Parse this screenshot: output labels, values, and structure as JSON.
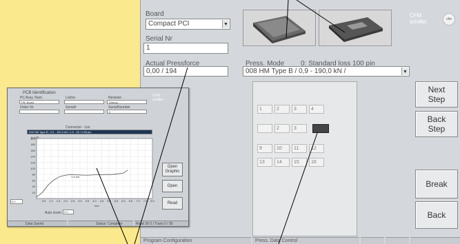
{
  "main": {
    "board_label": "Board",
    "board_value": "Compact PCI",
    "serial_label": "Serial Nr",
    "serial_value": "1",
    "actual_pressforce_label": "Actual Pressforce",
    "actual_pressforce_value": "0,00 / 194",
    "press_mode_label": "Press. Mode",
    "standard_label": "0: Standard loss 100 pin",
    "press_mode_value": "008  HM Type B / 0,9 - 190,0 kN /",
    "logo_text": [
      "CFM",
      "schiller"
    ],
    "buttons": {
      "next_step": [
        "Next",
        "Step"
      ],
      "back_step": [
        "Back",
        "Step"
      ],
      "break": "Break",
      "back": "Back"
    },
    "grid_rows": [
      [
        "1",
        "2",
        "3",
        "4"
      ],
      [
        "",
        "2",
        "3",
        ""
      ],
      [
        "9",
        "10",
        "11",
        "12"
      ],
      [
        "13",
        "14",
        "15",
        "16"
      ]
    ],
    "status_segments": [
      "Program Configuration",
      "Press. Data Control",
      "",
      "",
      ""
    ]
  },
  "inset": {
    "title": "PCB Identification",
    "fields": [
      {
        "label": "PC Assy. Num.",
        "value": "PB_Board"
      },
      {
        "label": "Lot/no.",
        "value": ""
      },
      {
        "label": "Revision",
        "value": "Startup"
      },
      {
        "label": "Order Nr.",
        "value": ""
      },
      {
        "label": "Serial#",
        "value": ""
      },
      {
        "label": "Serial/Number",
        "value": "0"
      }
    ],
    "graph_header": "Connector - List",
    "graph_selected": "008  HM Type B / 0,9 - 190,0 kN / 2.9 - 05 / 0.89 pin",
    "buttons": [
      "Open Graphic",
      "Open",
      "Read"
    ],
    "ylabel": "in kN",
    "xlabel": "mm",
    "left_field_value": "0.0",
    "auto_zoom_label": "Auto zoom",
    "auto_zoom_value": "0.0",
    "status_segments": [
      "Data Saved",
      "Status: Complete",
      "Read 36 0 / Trans 0 / 95"
    ],
    "logo_text": [
      "CFM",
      "schiller"
    ]
  },
  "chart_data": {
    "type": "line",
    "title": "",
    "xlabel": "mm",
    "ylabel": "in kN",
    "x_ticks": [
      "0.5",
      "1.0",
      "1.5",
      "2.0",
      "2.5",
      "3.0",
      "3.5",
      "4.0",
      "4.5",
      "5.0",
      "5.5",
      "6.0",
      "6.5",
      "7.0",
      "7.5",
      "8.0"
    ],
    "y_ticks": [
      "20",
      "40",
      "60",
      "80",
      "100",
      "120",
      "140",
      "160",
      "180",
      "200"
    ],
    "ylim": [
      0,
      200
    ],
    "xlim": [
      0,
      8
    ],
    "grid": true,
    "series": [
      {
        "x": [
          0,
          0.4,
          0.8,
          1.2,
          1.6,
          2.0,
          2.4,
          2.8,
          3.2,
          3.6,
          4.0,
          4.4,
          4.8,
          5.2,
          5.6,
          6.0,
          6.3
        ],
        "y": [
          5,
          20,
          45,
          62,
          73,
          78,
          80,
          79,
          78,
          78,
          79,
          79,
          80,
          80,
          82,
          85,
          95
        ]
      }
    ],
    "annotation": "0.0 kN"
  }
}
